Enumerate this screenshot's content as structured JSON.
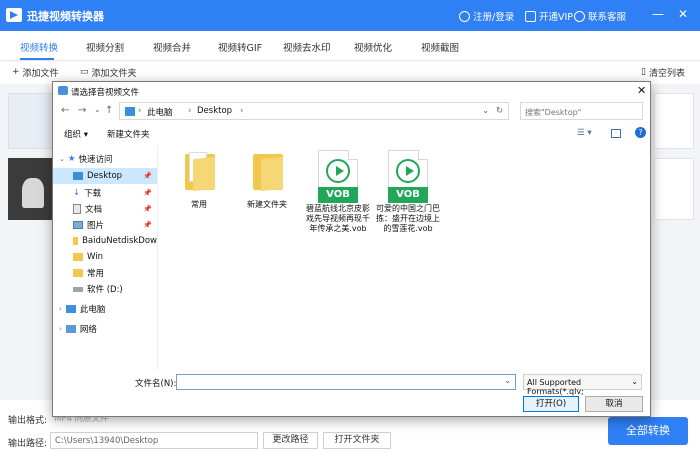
{
  "app": {
    "title": "迅捷视频转换器",
    "header_links": [
      "注册/登录",
      "开通VIP",
      "联系客服"
    ]
  },
  "nav": {
    "tabs": [
      "视频转换",
      "视频分割",
      "视频合并",
      "视频转GIF",
      "视频去水印",
      "视频优化",
      "视频截图"
    ],
    "active": "视频转换"
  },
  "toolbar": {
    "add_file": "添加文件",
    "add_folder": "添加文件夹",
    "clear_list": "清空列表"
  },
  "bottom": {
    "format_label": "输出格式:",
    "format_value": "MP4 同原文件",
    "path_label": "输出路径:",
    "path_value": "C:\\Users\\13940\\Desktop",
    "change_path": "更改路径",
    "open_folder": "打开文件夹",
    "convert_all": "全部转换"
  },
  "dialog": {
    "title": "请选择音视频文件",
    "breadcrumb": [
      "此电脑",
      "Desktop"
    ],
    "search_placeholder": "搜索\"Desktop\"",
    "organize": "组织",
    "new_folder": "新建文件夹",
    "tree": [
      {
        "label": "快速访问",
        "level": 0
      },
      {
        "label": "Desktop",
        "level": 1,
        "selected": true,
        "pinned": true
      },
      {
        "label": "下载",
        "level": 1,
        "pinned": true
      },
      {
        "label": "文档",
        "level": 1,
        "pinned": true
      },
      {
        "label": "图片",
        "level": 1,
        "pinned": true
      },
      {
        "label": "BaiduNetdiskDow",
        "level": 1
      },
      {
        "label": "Win",
        "level": 1
      },
      {
        "label": "常用",
        "level": 1
      },
      {
        "label": "软件 (D:)",
        "level": 1
      },
      {
        "label": "此电脑",
        "level": 0
      },
      {
        "label": "网络",
        "level": 0
      }
    ],
    "files": [
      {
        "name": "常用",
        "type": "folder"
      },
      {
        "name": "新建文件夹",
        "type": "folder"
      },
      {
        "name": "碧蓝航线北京皮影戏先导视频再现千年传承之美.vob",
        "type": "vob"
      },
      {
        "name": "可爱的中国之门巴拣：盛开在边境上的雪莲花.vob",
        "type": "vob"
      }
    ],
    "vob_badge": "VOB",
    "filename_label": "文件名(N):",
    "format_filter": "All Supported Formats(*.qlv;",
    "open_button": "打开(O)",
    "cancel_button": "取消"
  }
}
